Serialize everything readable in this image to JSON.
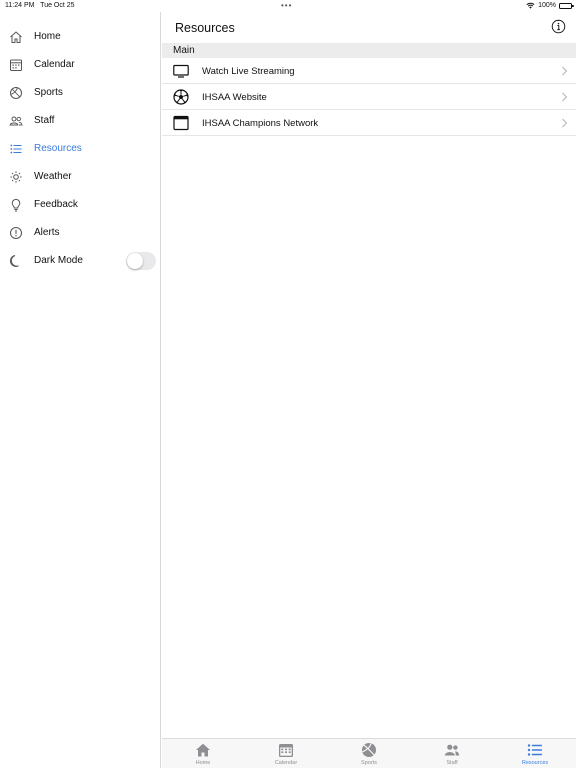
{
  "status_bar": {
    "time": "11:24 PM",
    "date": "Tue Oct 25",
    "battery": "100%"
  },
  "sidebar": {
    "items": [
      {
        "label": "Home",
        "icon": "house-icon"
      },
      {
        "label": "Calendar",
        "icon": "calendar-icon"
      },
      {
        "label": "Sports",
        "icon": "ball-icon"
      },
      {
        "label": "Staff",
        "icon": "people-icon"
      },
      {
        "label": "Resources",
        "icon": "list-icon",
        "active": true
      },
      {
        "label": "Weather",
        "icon": "sun-icon"
      },
      {
        "label": "Feedback",
        "icon": "lightbulb-icon"
      },
      {
        "label": "Alerts",
        "icon": "alert-icon"
      },
      {
        "label": "Dark Mode",
        "icon": "moon-icon",
        "toggle": false
      }
    ]
  },
  "main": {
    "title": "Resources",
    "section": "Main",
    "rows": [
      {
        "label": "Watch Live Streaming",
        "icon": "tv-icon"
      },
      {
        "label": "IHSAA Website",
        "icon": "soccer-ball-icon"
      },
      {
        "label": "IHSAA Champions Network",
        "icon": "browser-window-icon"
      }
    ]
  },
  "tab_bar": {
    "tabs": [
      {
        "label": "Home",
        "icon": "house-icon"
      },
      {
        "label": "Calendar",
        "icon": "calendar-icon"
      },
      {
        "label": "Sports",
        "icon": "ball-icon"
      },
      {
        "label": "Staff",
        "icon": "people-icon"
      },
      {
        "label": "Resources",
        "icon": "list-icon",
        "active": true
      }
    ]
  },
  "colors": {
    "accent": "#3b7ddd",
    "inactive": "#8e8e93",
    "section_bg": "#ececec"
  }
}
